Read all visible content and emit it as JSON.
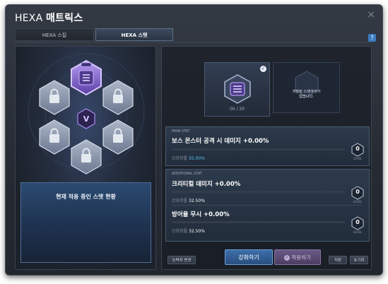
{
  "window": {
    "title_prefix": "HEXA",
    "title_main": "매트릭스",
    "close_label": "×",
    "help_label": "?"
  },
  "tabs": [
    {
      "label": "HEXA 스킬",
      "active": false
    },
    {
      "label": "HEXA 스탯",
      "active": true
    }
  ],
  "left_panel": {
    "status_title": "현재 적용 중인 스탯 현황",
    "center_symbol": "V"
  },
  "core": {
    "count": "00 / 20",
    "description": "저장된 스탯코어가\n없습니다."
  },
  "main_stat": {
    "section_label": "MAIN STAT",
    "name": "보스 몬스터 공격 시 데미지 +0.00%",
    "rate_label": "강화확률",
    "rate_value": "35.00%",
    "level": "0",
    "level_label": "LEVEL"
  },
  "additional_stat": {
    "section_label": "ADDITIONAL STAT",
    "items": [
      {
        "name": "크리티컬 데미지 +0.00%",
        "rate_label": "강화확률",
        "rate_value": "32.50%",
        "level": "0",
        "level_label": "LEVEL"
      },
      {
        "name": "방어율 무시 +0.00%",
        "rate_label": "강화확률",
        "rate_value": "32.50%",
        "level": "0",
        "level_label": "LEVEL"
      }
    ]
  },
  "buttons": {
    "ability_change": "능력치 변경",
    "upgrade": "강화하기",
    "apply": "적용하기",
    "save": "저장",
    "reset": "초기화"
  },
  "colors": {
    "accent_blue": "#55c6ff",
    "upgrade_button": "#3d6ea9",
    "apply_button": "#6a5886",
    "core_purple": "#8a6cd8"
  }
}
